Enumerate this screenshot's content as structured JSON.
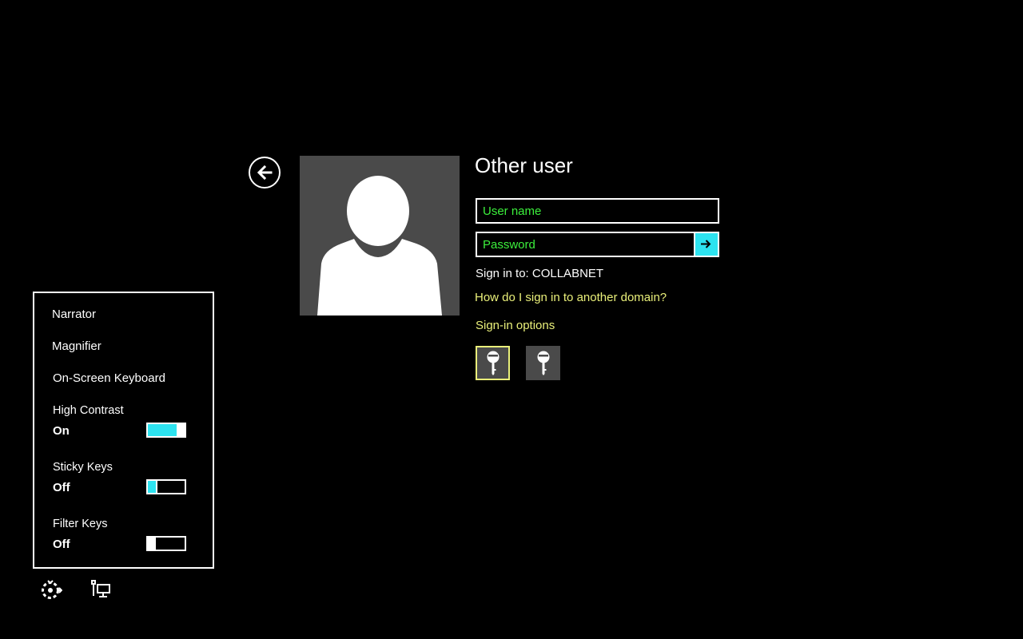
{
  "login": {
    "title": "Other user",
    "username_placeholder": "User name",
    "password_placeholder": "Password",
    "sign_in_to": "Sign in to: COLLABNET",
    "domain_link": "How do I sign in to another domain?",
    "sign_in_options": "Sign-in options",
    "option_icons": [
      "key-icon",
      "key-icon"
    ]
  },
  "ease_of_access": {
    "items": [
      "Narrator",
      "Magnifier",
      "On-Screen Keyboard"
    ],
    "toggles": [
      {
        "label": "High Contrast",
        "state": "On",
        "on": true
      },
      {
        "label": "Sticky Keys",
        "state": "Off",
        "on": false
      },
      {
        "label": "Filter Keys",
        "state": "Off",
        "on": false
      }
    ]
  },
  "colors": {
    "background": "#000000",
    "input_text": "#3cf03c",
    "link": "#eaf07a",
    "accent": "#2de3f0",
    "tile": "#4a4a4a"
  },
  "icons": [
    "back-arrow-icon",
    "arrow-right-icon",
    "ease-of-access-icon",
    "network-icon"
  ]
}
